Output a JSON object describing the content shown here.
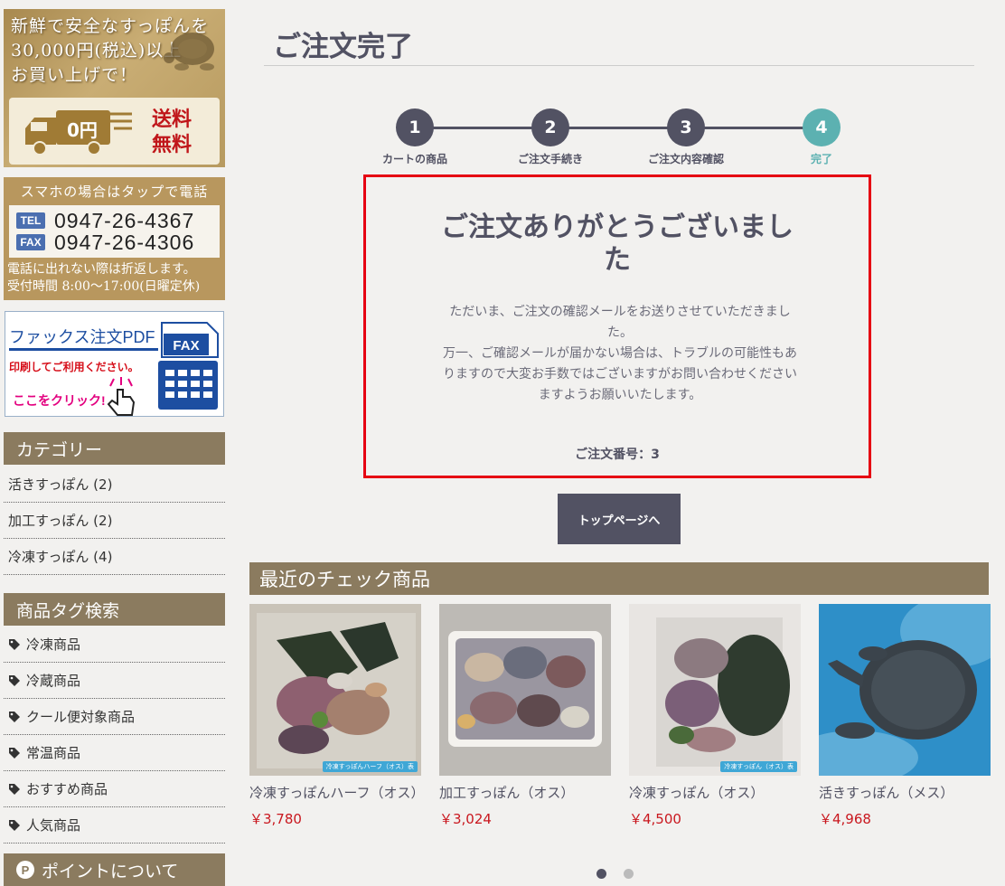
{
  "sidebar": {
    "shipping_banner": {
      "lines": [
        "新鮮で安全なすっぽんを",
        "30,000円(税込)以上",
        "お買い上げで！"
      ],
      "truck_text": "0円",
      "free_text": [
        "送料",
        "無料"
      ]
    },
    "tel_banner": {
      "heading": "スマホの場合はタップで電話",
      "tel_label": "TEL",
      "tel_number": "0947-26-4367",
      "fax_label": "FAX",
      "fax_number": "0947-26-4306",
      "note_lines": [
        "電話に出れない際は折返します。",
        "受付時間 8:00～17:00(日曜定休)"
      ]
    },
    "fax_banner": {
      "title": "ファックス注文PDF",
      "machine_label": "FAX",
      "note": "印刷してご利用ください。",
      "click": "ここをクリック!"
    },
    "category_heading": "カテゴリー",
    "categories": [
      "活きすっぽん (2)",
      "加工すっぽん (2)",
      "冷凍すっぽん (4)"
    ],
    "tag_heading": "商品タグ検索",
    "tags": [
      "冷凍商品",
      "冷蔵商品",
      "クール便対象商品",
      "常温商品",
      "おすすめ商品",
      "人気商品"
    ],
    "points_icon": "P",
    "points_heading": "ポイントについて"
  },
  "main": {
    "page_title": "ご注文完了",
    "steps": [
      {
        "num": "1",
        "label": "カートの商品"
      },
      {
        "num": "2",
        "label": "ご注文手続き"
      },
      {
        "num": "3",
        "label": "ご注文内容確認"
      },
      {
        "num": "4",
        "label": "完了"
      }
    ],
    "thanks_title": "ご注文ありがとうございました",
    "thanks_body_1": "ただいま、ご注文の確認メールをお送りさせていただきました。",
    "thanks_body_2": "万一、ご確認メールが届かない場合は、トラブルの可能性もありますので大変お手数ではございますがお問い合わせくださいますようお願いいたします。",
    "order_number": "ご注文番号：3",
    "top_button": "トップページへ",
    "recent_heading": "最近のチェック商品",
    "products": [
      {
        "name": "冷凍すっぽんハーフ（オス）",
        "price": "￥3,780",
        "caption": "冷凍すっぽんハーフ（オス）表"
      },
      {
        "name": "加工すっぽん（オス）",
        "price": "￥3,024",
        "caption": ""
      },
      {
        "name": "冷凍すっぽん（オス）",
        "price": "￥4,500",
        "caption": "冷凍すっぽん（オス）表"
      },
      {
        "name": "活きすっぽん（メス）",
        "price": "￥4,968",
        "caption": ""
      }
    ]
  },
  "colors": {
    "brand_brown": "#8b7b5f",
    "text_dark": "#525263",
    "accent_teal": "#5cb1b1",
    "price_red": "#c9171e",
    "highlight_red": "#e60012"
  }
}
